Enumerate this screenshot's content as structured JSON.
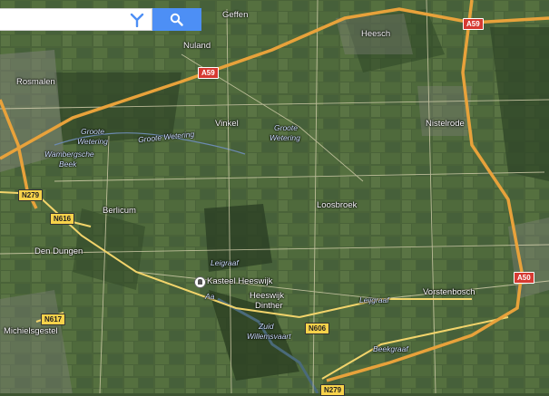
{
  "search": {
    "placeholder": "",
    "value": "",
    "directions_icon": "directions-icon",
    "search_icon": "search-icon"
  },
  "colors": {
    "accent": "#4d8ff5",
    "motorway": "#e8a23b",
    "road": "#f2d46b"
  },
  "places": {
    "geffen": "Geffen",
    "nuland": "Nuland",
    "heesch": "Heesch",
    "rosmalen": "Rosmalen",
    "vinkel": "Vinkel",
    "nistelrode": "Nistelrode",
    "berlicum": "Berlicum",
    "loosbroek": "Loosbroek",
    "den_dungen": "Den Dungen",
    "kasteel": "Kasteel Heeswijk",
    "heeswijk": "Heeswijk",
    "dinther": "Dinther",
    "vorstenbosch": "Vorstenbosch",
    "michielsgestel": "Michielsgestel"
  },
  "waters": {
    "groote_wetering_1": "Groote",
    "groote_wetering_2": "Wetering",
    "groote_wetering_3": "Groote Wetering",
    "groote_wetering_4": "Groote",
    "groote_wetering_5": "Wetering",
    "wambergsche_1": "Wambergsche",
    "wambergsche_2": "Beek",
    "leigraaf_1": "Leigraaf",
    "leigraaf_2": "Leijgraaf",
    "aa": "Aa",
    "zuid_1": "Zuid",
    "zuid_2": "Willemsvaart",
    "beekgraaf": "Beekgraaf"
  },
  "roads": {
    "a59_left": "A59",
    "a59_right": "A59",
    "a50": "A50",
    "n279_left": "N279",
    "n279_bottom": "N279",
    "n616": "N616",
    "n617": "N617",
    "n606": "N606"
  }
}
